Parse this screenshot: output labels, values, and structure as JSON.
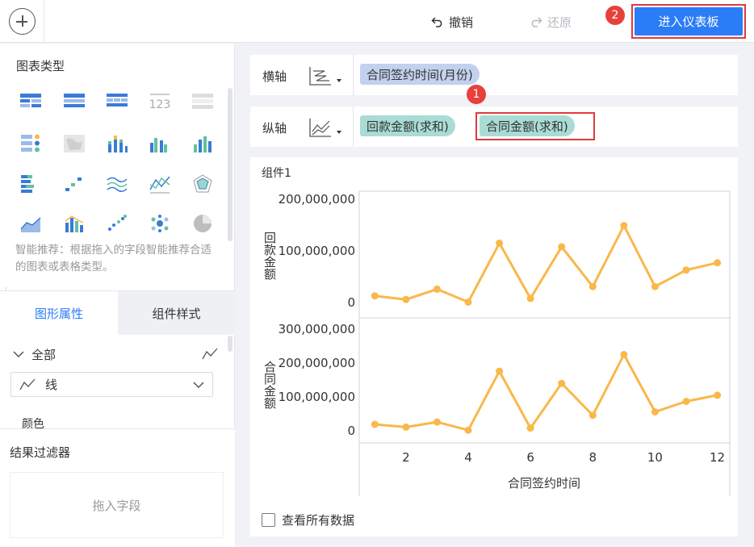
{
  "toolbar": {
    "undo_label": "撤销",
    "redo_label": "还原",
    "enter_dashboard_label": "进入仪表板",
    "badge_2": "2",
    "badge_1": "1"
  },
  "left_panel": {
    "chart_types_title": "图表类型",
    "hint": "智能推荐：根据拖入的字段智能推荐合适的图表或表格类型。",
    "tabs": [
      "图形属性",
      "组件样式"
    ],
    "attr_all_label": "全部",
    "line_select_value": "线",
    "color_label": "颜色",
    "filter_title": "结果过滤器",
    "drop_placeholder": "拖入字段"
  },
  "axes": {
    "x_label": "横轴",
    "y_label": "纵轴",
    "x_fields": [
      "合同签约时间(月份)"
    ],
    "y_fields": [
      "回款金额(求和)",
      "合同金额(求和)"
    ]
  },
  "component": {
    "title": "组件1",
    "view_all_data_label": "查看所有数据"
  },
  "chart_data": {
    "type": "line",
    "xlabel": "合同签约时间",
    "x_ticks": [
      2,
      4,
      6,
      8,
      10,
      12
    ],
    "xlim": [
      0.5,
      12.4
    ],
    "x": [
      1,
      2,
      3,
      4,
      5,
      6,
      7,
      8,
      9,
      10,
      11,
      12
    ],
    "line_color": "#f9b84a",
    "series": [
      {
        "name": "回款金额",
        "ylabel": "回款金额",
        "ylim": [
          0,
          200000000
        ],
        "y_ticks": [
          "200,000,000",
          "100,000,000",
          "0"
        ],
        "values": [
          13000000,
          6000000,
          26000000,
          1000000,
          115000000,
          8000000,
          108000000,
          31000000,
          149000000,
          31000000,
          63000000,
          77000000
        ]
      },
      {
        "name": "合同金额",
        "ylabel": "合同金额",
        "ylim": [
          0,
          300000000
        ],
        "y_ticks": [
          "300,000,000",
          "200,000,000",
          "100,000,000",
          "0"
        ],
        "values": [
          19000000,
          11000000,
          26000000,
          2000000,
          176000000,
          8000000,
          140000000,
          46000000,
          225000000,
          56000000,
          87000000,
          105000000
        ]
      }
    ]
  },
  "colors": {
    "primary": "#2b7cf7",
    "highlight_red": "#e03a3a",
    "pill_blue": "#c2d1ee",
    "pill_green": "#a9dcd5"
  }
}
